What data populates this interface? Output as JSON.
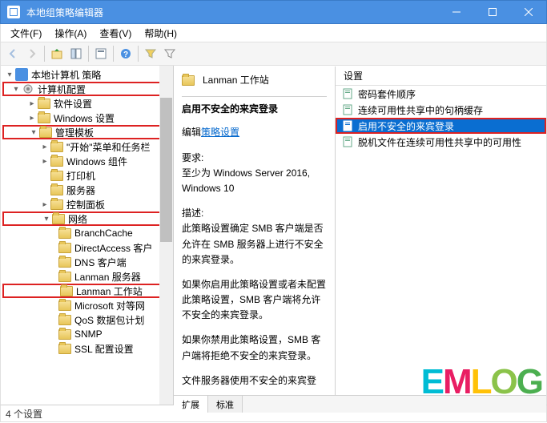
{
  "window": {
    "title": "本地组策略编辑器"
  },
  "menu": {
    "file": "文件(F)",
    "action": "操作(A)",
    "view": "查看(V)",
    "help": "帮助(H)"
  },
  "tree": {
    "root": "本地计算机 策略",
    "computer_config": "计算机配置",
    "software_settings": "软件设置",
    "windows_settings": "Windows 设置",
    "admin_templates": "管理模板",
    "start_taskbar": "\"开始\"菜单和任务栏",
    "windows_components": "Windows 组件",
    "printers": "打印机",
    "server": "服务器",
    "control_panel": "控制面板",
    "network": "网络",
    "branchcache": "BranchCache",
    "directaccess": "DirectAccess 客户",
    "dns_client": "DNS 客户端",
    "lanman_server": "Lanman 服务器",
    "lanman_workstation": "Lanman 工作站",
    "ms_peer": "Microsoft 对等网",
    "qos": "QoS 数据包计划",
    "snmp": "SNMP",
    "ssl_config": "SSL 配置设置"
  },
  "detail": {
    "header_name": "Lanman 工作站",
    "title": "启用不安全的来宾登录",
    "edit_prefix": "编辑",
    "edit_link": "策略设置",
    "req_label": "要求:",
    "req_text": "至少为 Windows Server 2016, Windows 10",
    "desc_label": "描述:",
    "desc1": "此策略设置确定 SMB 客户端是否允许在 SMB 服务器上进行不安全的来宾登录。",
    "desc2": "如果你启用此策略设置或者未配置此策略设置，SMB 客户端将允许不安全的来宾登录。",
    "desc3": "如果你禁用此策略设置，SMB 客户端将拒绝不安全的来宾登录。",
    "desc4": "文件服务器使用不安全的来宾登"
  },
  "settings": {
    "header": "设置",
    "items": [
      "密码套件顺序",
      "连续可用性共享中的句柄缓存",
      "启用不安全的来宾登录",
      "脱机文件在连续可用性共享中的可用性"
    ],
    "selected_index": 2
  },
  "tabs": {
    "extended": "扩展",
    "standard": "标准"
  },
  "status": {
    "text": "4 个设置"
  },
  "watermark": "EMLOG"
}
